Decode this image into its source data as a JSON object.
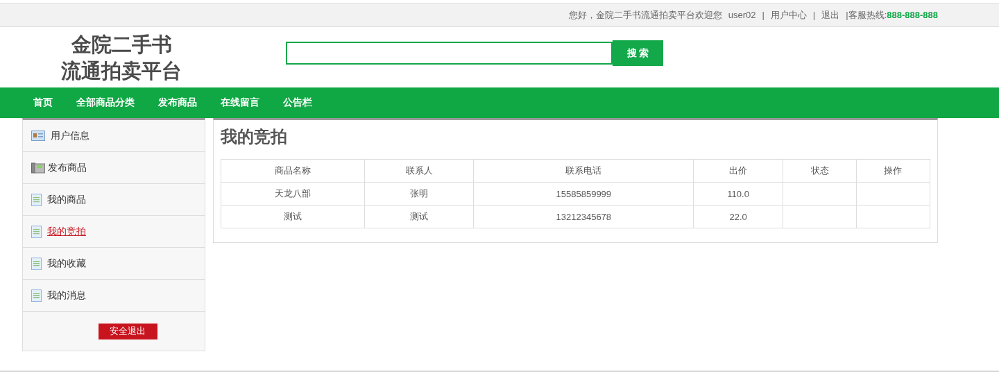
{
  "top_bar": {
    "items": [
      {
        "kind": "text",
        "text": "您好，金院二手书流通拍卖平台欢迎您"
      },
      {
        "kind": "link",
        "text": "user02"
      },
      {
        "kind": "sep",
        "text": "|"
      },
      {
        "kind": "link",
        "text": "用户中心"
      },
      {
        "kind": "sep",
        "text": "|"
      },
      {
        "kind": "link",
        "text": "退出"
      },
      {
        "kind": "sep",
        "text": "|"
      },
      {
        "kind": "text",
        "text": "客服热线:"
      },
      {
        "kind": "phone",
        "text": "888-888-888"
      }
    ]
  },
  "logo": {
    "lines": [
      "金院二手书",
      "流通拍卖平台"
    ]
  },
  "search": {
    "button": "搜 索"
  },
  "nav": [
    "首页",
    "全部商品分类",
    "发布商品",
    "在线留言",
    "公告栏"
  ],
  "sidebar": {
    "items": [
      {
        "label": "用户信息",
        "kind": "card",
        "selected": false
      },
      {
        "label": "发布商品",
        "kind": "phone",
        "selected": false
      },
      {
        "label": "我的商品",
        "kind": "doc",
        "selected": false
      },
      {
        "label": "我的竞拍",
        "kind": "doc",
        "selected": true
      },
      {
        "label": "我的收藏",
        "kind": "doc",
        "selected": false
      },
      {
        "label": "我的消息",
        "kind": "doc",
        "selected": false
      }
    ],
    "logout": "安全退出"
  },
  "content": {
    "title": "我的竞拍",
    "table": {
      "columns": [
        "商品名称",
        "联系人",
        "联系电话",
        "出价",
        "状态",
        "操作"
      ],
      "rows": [
        [
          "天龙八部",
          "张明",
          "15585859999",
          "110.0",
          "",
          ""
        ],
        [
          "测试",
          "测试",
          "13212345678",
          "22.0",
          "",
          ""
        ]
      ]
    }
  }
}
